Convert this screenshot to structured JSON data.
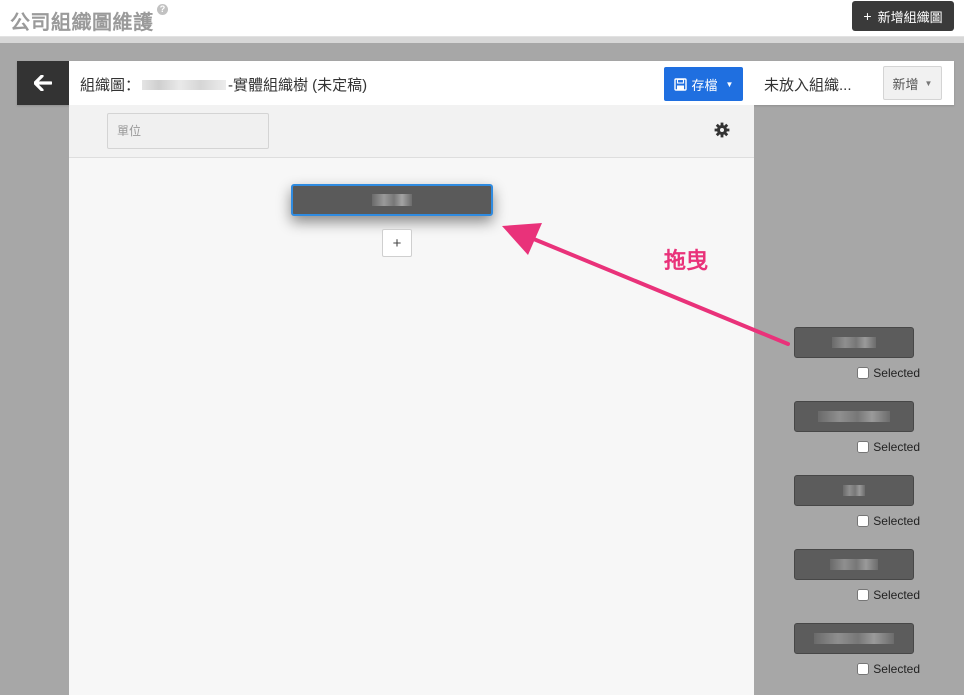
{
  "page": {
    "title": "公司組織圖維護",
    "help_icon": "question-circle-icon",
    "add_chart_label": "新增組織圖",
    "add_chart_icon": "plus-icon"
  },
  "modal": {
    "back_icon": "arrow-left-icon",
    "title_prefix": "組織圖：",
    "title_suffix": "-實體組織樹 (未定稿)",
    "save_label": "存檔",
    "save_icon": "floppy-disk-icon",
    "unplaced_label": "未放入組織...",
    "new_label": "新增"
  },
  "canvas": {
    "unit_placeholder": "單位",
    "settings_icon": "gear-icon",
    "add_child_label": "+"
  },
  "annotation": {
    "drag_label": "拖曳",
    "color": "#e9327a"
  },
  "unplaced_items": [
    {
      "selected_label": "Selected",
      "checked": false
    },
    {
      "selected_label": "Selected",
      "checked": false
    },
    {
      "selected_label": "Selected",
      "checked": false
    },
    {
      "selected_label": "Selected",
      "checked": false
    },
    {
      "selected_label": "Selected",
      "checked": false
    }
  ],
  "colors": {
    "primary": "#1f6fe0",
    "node_border_active": "#2f8be0",
    "dark": "#333333"
  }
}
